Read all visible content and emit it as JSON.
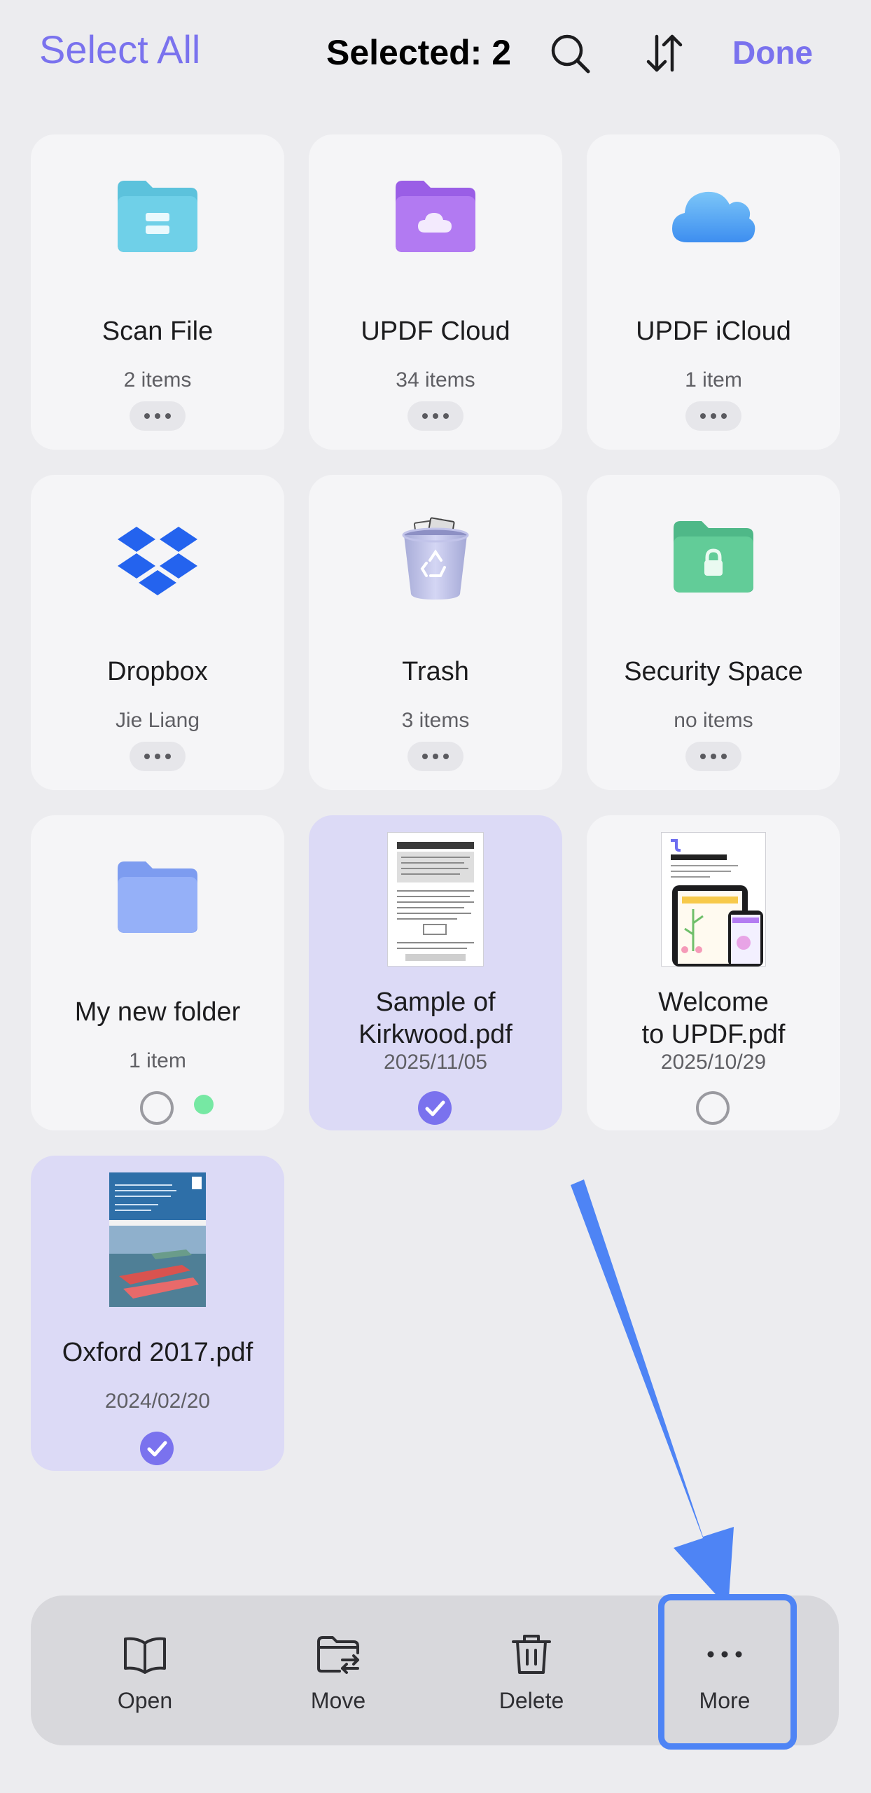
{
  "header": {
    "select_all_label": "Select All",
    "selected_label": "Selected: 2",
    "search_icon": "search-icon",
    "sort_icon": "sort-icon",
    "done_label": "Done"
  },
  "items": [
    {
      "name": "Scan File",
      "sub": "2 items",
      "icon": "scan-folder-icon"
    },
    {
      "name": "UPDF Cloud",
      "sub": "34 items",
      "icon": "cloud-folder-icon"
    },
    {
      "name": "UPDF iCloud",
      "sub": "1 item",
      "icon": "icloud-icon"
    },
    {
      "name": "Dropbox",
      "sub": "Jie Liang",
      "icon": "dropbox-icon"
    },
    {
      "name": "Trash",
      "sub": "3 items",
      "icon": "trash-bin-icon"
    },
    {
      "name": "Security Space",
      "sub": "no items",
      "icon": "lock-folder-icon"
    },
    {
      "name": "My new folder",
      "sub": "1 item",
      "icon": "folder-icon",
      "selected": false
    },
    {
      "name_line1": "Sample of",
      "name_line2": "Kirkwood.pdf",
      "sub": "2025/11/05",
      "icon": "pdf-thumbnail-icon",
      "selected": true
    },
    {
      "name_line1": "Welcome",
      "name_line2": "to UPDF.pdf",
      "sub": "2025/10/29",
      "icon": "pdf-thumbnail-icon",
      "selected": false
    },
    {
      "name": "Oxford 2017.pdf",
      "sub": "2024/02/20",
      "icon": "book-cover-icon",
      "selected": true
    }
  ],
  "toolbar": {
    "open_label": "Open",
    "move_label": "Move",
    "delete_label": "Delete",
    "more_label": "More"
  },
  "colors": {
    "accent": "#7a72ee",
    "selected_card": "#dcdaf6",
    "annotation": "#4e84f5"
  }
}
